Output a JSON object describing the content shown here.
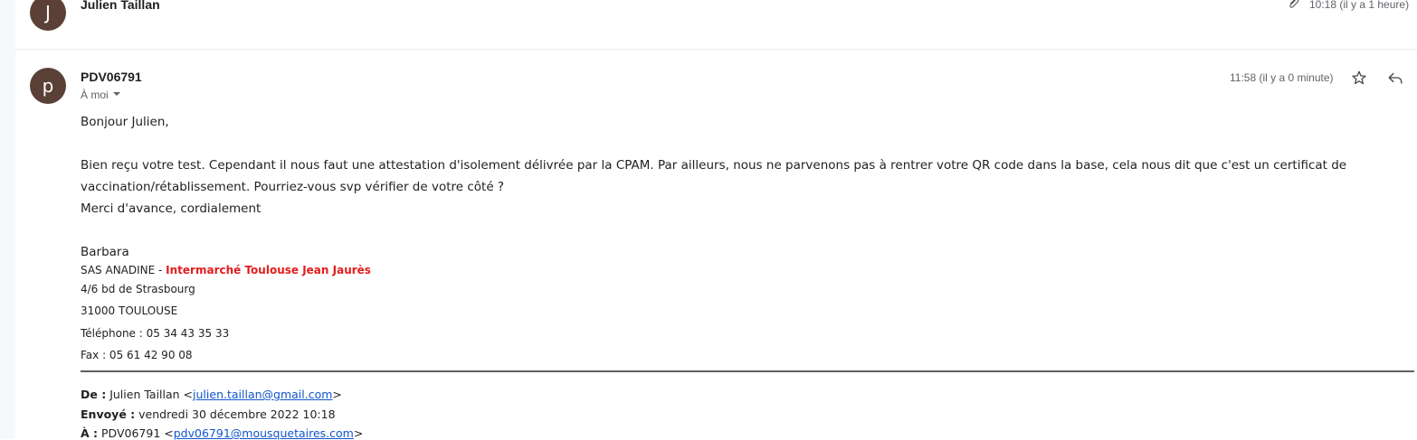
{
  "previous_message": {
    "avatar_letter": "J",
    "sender": "Julien Taillan",
    "time": "10:18 (il y a 1 heure)",
    "attachment_icon": "paperclip-icon"
  },
  "message": {
    "avatar_letter": "p",
    "sender": "PDV06791",
    "time": "11:58 (il y a 0 minute)",
    "to_label": "À moi",
    "star_icon": "star-icon",
    "reply_icon": "reply-icon",
    "greeting": "Bonjour Julien,",
    "paragraph1_line1": "Bien reçu votre test. Cependant il nous faut une attestation d'isolement délivrée par la CPAM. Par ailleurs, nous ne parvenons pas à rentrer votre QR code dans la base, cela nous dit que c'est un certificat de",
    "paragraph1_line2": "vaccination/rétablissement. Pourriez-vous svp vérifier de votre côté ?",
    "closing": "Merci d'avance, cordialement",
    "signature": {
      "name": "Barbara",
      "company_prefix": "SAS ANADINE - ",
      "company_store": "Intermarché Toulouse Jean Jaurès",
      "address1": "4/6 bd de Strasbourg",
      "address2": "31000 TOULOUSE",
      "phone": "Téléphone : 05 34 43 35 33",
      "fax": "Fax : 05 61 42 90 08"
    },
    "forwarded": {
      "from_label": "De :",
      "from_name": "Julien Taillan <",
      "from_email": "julien.taillan@gmail.com",
      "from_close": ">",
      "sent_label": "Envoyé :",
      "sent_value": "vendredi 30 décembre 2022 10:18",
      "to_label": "À :",
      "to_name": "PDV06791 <",
      "to_email": "pdv06791@mousquetaires.com",
      "to_close": ">"
    }
  },
  "colors": {
    "avatar_bg": "#5b4037",
    "signature_red": "#e31c1c",
    "link": "#1155cc"
  }
}
